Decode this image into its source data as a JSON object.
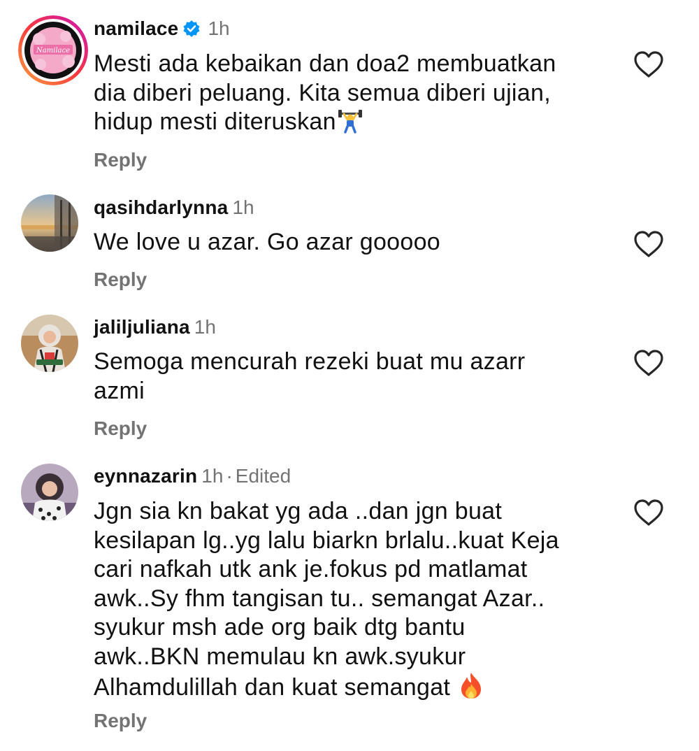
{
  "comments": [
    {
      "username": "namilace",
      "verified": true,
      "time": "1h",
      "avatar_text": "Namilace",
      "lines": [
        "Mesti ada kebaikan dan doa2 membuatkan",
        "dia diberi peluang. Kita semua diberi ujian,",
        "hidup mesti diteruskan"
      ],
      "emoji": "weightlifter-emoji",
      "reply": "Reply"
    },
    {
      "username": "qasihdarlynna",
      "time": "1h",
      "lines": [
        "We love u azar. Go azar gooooo"
      ],
      "reply": "Reply"
    },
    {
      "username": "jaliljuliana",
      "time": "1h",
      "lines": [
        "Semoga mencurah rezeki buat mu azarr",
        "azmi"
      ],
      "reply": "Reply"
    },
    {
      "username": "eynnazarin",
      "time": "1h",
      "edited_sep": "·",
      "edited": "Edited",
      "lines": [
        "Jgn sia kn bakat yg ada ..dan jgn buat",
        "kesilapan lg..yg lalu biarkn brlalu..kuat Keja",
        "cari nafkah utk ank je.fokus pd matlamat",
        "awk..Sy fhm tangisan tu.. semangat Azar..",
        "syukur msh ade org baik dtg bantu",
        "awk..BKN memulau kn awk.syukur",
        "Alhamdulillah dan kuat semangat"
      ],
      "emoji": "fire-emoji",
      "reply": "Reply"
    }
  ],
  "icons": {
    "like": "heart-outline-icon",
    "verified": "verified-badge-icon"
  },
  "colors": {
    "text": "#111111",
    "secondary": "#737373",
    "verified": "#0095f6",
    "story_ring_start": "#c913b9",
    "story_ring_end": "#f9373f"
  }
}
